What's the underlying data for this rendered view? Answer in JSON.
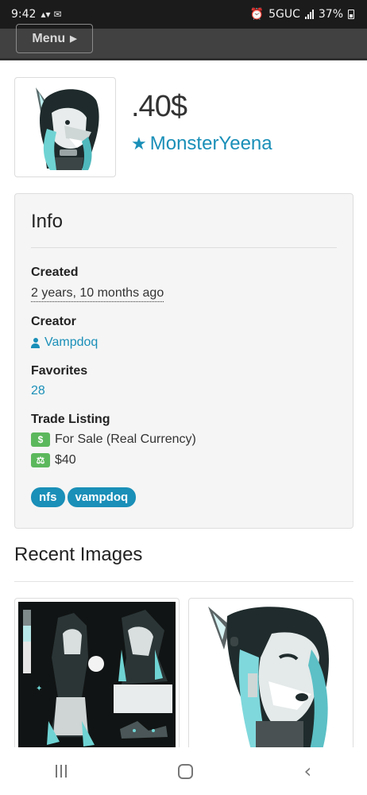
{
  "status_bar": {
    "time": "9:42",
    "network": "5GUC",
    "battery": "37%"
  },
  "navbar": {
    "menu_label": "Menu"
  },
  "character": {
    "name": ".40$",
    "owner": "MonsterYeena"
  },
  "info": {
    "title": "Info",
    "created_label": "Created",
    "created_value": "2 years, 10 months ago",
    "creator_label": "Creator",
    "creator_value": "Vampdoq",
    "favorites_label": "Favorites",
    "favorites_value": "28",
    "trade_label": "Trade Listing",
    "trade_status": "For Sale (Real Currency)",
    "trade_price": "$40",
    "dollar_badge": "$",
    "tags": [
      "nfs",
      "vampdoq"
    ]
  },
  "recent": {
    "title": "Recent Images"
  },
  "colors": {
    "accent": "#1a8fb8",
    "navbar": "#414141",
    "success": "#5cb85c",
    "panel_bg": "#f5f5f5"
  },
  "icons": {
    "owner": "star-icon",
    "creator": "user-icon",
    "sale": "dollar-icon",
    "price": "scale-icon"
  }
}
